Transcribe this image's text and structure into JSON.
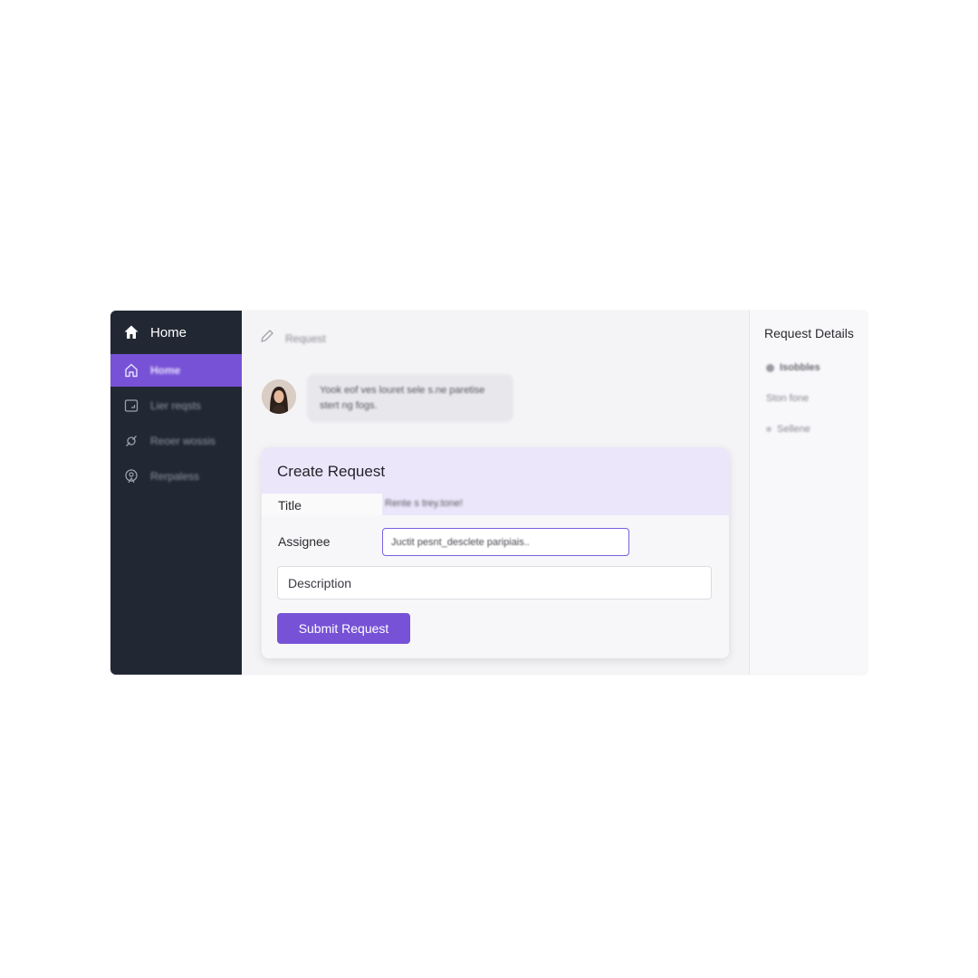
{
  "sidebar": {
    "header": {
      "icon": "home-icon",
      "label": "Home"
    },
    "items": [
      {
        "icon": "home-outline-icon",
        "label": "Home",
        "active": true
      },
      {
        "icon": "inbox-icon",
        "label": "Lier reqsts",
        "active": false
      },
      {
        "icon": "link-icon",
        "label": "Reoer wossis",
        "active": false
      },
      {
        "icon": "settings-badge-icon",
        "label": "Rerpaless",
        "active": false
      }
    ]
  },
  "topbar": {
    "icon": "pencil-icon",
    "breadcrumb": "Request"
  },
  "message": {
    "avatar": "user-avatar",
    "line1": "Yook eof ves louret sele s.ne paretise",
    "line2": "stert ng fogs."
  },
  "form": {
    "title": "Create Request",
    "title_label": "Title",
    "title_value": "Rente s trey.tone!",
    "assignee_label": "Assignee",
    "assignee_value": "Juctit pesnt_desclete paripiais..",
    "description_placeholder": "Description",
    "submit_label": "Submit Request"
  },
  "details": {
    "title": "Request Details",
    "items": [
      {
        "icon": "status-dot-icon",
        "label": "Isobbles"
      },
      {
        "icon": "",
        "label": "Ston fone"
      },
      {
        "icon": "status-dot-icon",
        "label": "Sellene"
      }
    ]
  },
  "colors": {
    "accent": "#7752d6",
    "sidebar_bg": "#222833",
    "card_header": "#ebe6fa"
  }
}
